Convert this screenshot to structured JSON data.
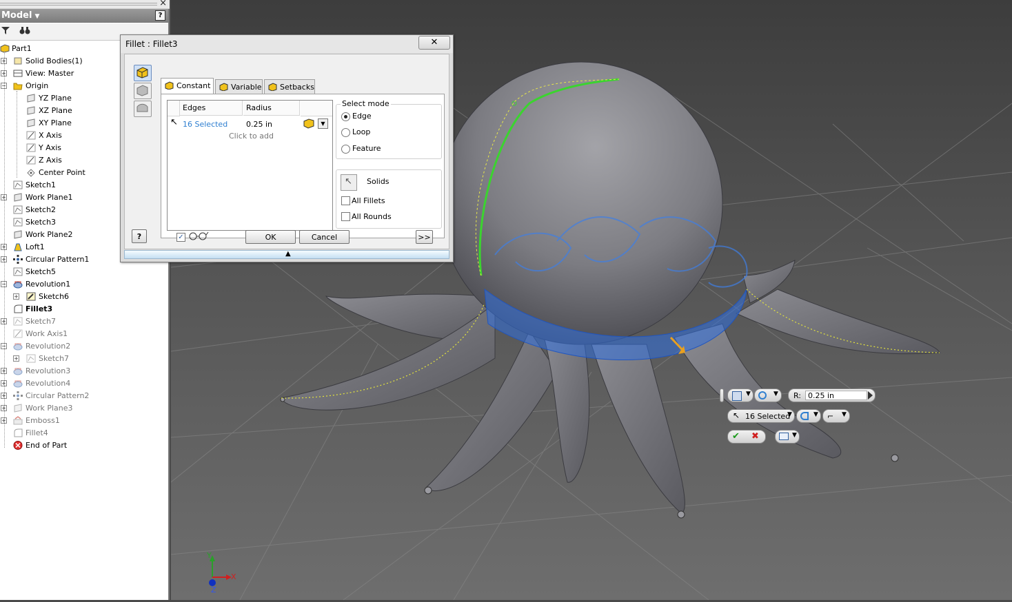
{
  "browser": {
    "title": "Model",
    "help": "?",
    "close": "×",
    "tree": [
      {
        "label": "Part1",
        "x": 0,
        "exp": "",
        "icon": "part-icon",
        "style": ""
      },
      {
        "label": "Solid Bodies(1)",
        "x": 1,
        "exp": "+",
        "icon": "solid-bodies-icon",
        "style": ""
      },
      {
        "label": "View: Master",
        "x": 1,
        "exp": "+",
        "icon": "view-icon",
        "style": ""
      },
      {
        "label": "Origin",
        "x": 1,
        "exp": "-",
        "icon": "folder-icon",
        "style": ""
      },
      {
        "label": "YZ Plane",
        "x": 2,
        "exp": "",
        "icon": "plane-icon",
        "style": ""
      },
      {
        "label": "XZ Plane",
        "x": 2,
        "exp": "",
        "icon": "plane-icon",
        "style": ""
      },
      {
        "label": "XY Plane",
        "x": 2,
        "exp": "",
        "icon": "plane-icon",
        "style": ""
      },
      {
        "label": "X Axis",
        "x": 2,
        "exp": "",
        "icon": "axis-icon",
        "style": ""
      },
      {
        "label": "Y Axis",
        "x": 2,
        "exp": "",
        "icon": "axis-icon",
        "style": ""
      },
      {
        "label": "Z Axis",
        "x": 2,
        "exp": "",
        "icon": "axis-icon",
        "style": ""
      },
      {
        "label": "Center Point",
        "x": 2,
        "exp": "",
        "icon": "point-icon",
        "style": ""
      },
      {
        "label": "Sketch1",
        "x": 1,
        "exp": "",
        "icon": "sketch-icon",
        "style": ""
      },
      {
        "label": "Work Plane1",
        "x": 1,
        "exp": "+",
        "icon": "plane-icon",
        "style": ""
      },
      {
        "label": "Sketch2",
        "x": 1,
        "exp": "",
        "icon": "sketch-icon",
        "style": ""
      },
      {
        "label": "Sketch3",
        "x": 1,
        "exp": "",
        "icon": "sketch-icon",
        "style": ""
      },
      {
        "label": "Work Plane2",
        "x": 1,
        "exp": "",
        "icon": "plane-icon",
        "style": ""
      },
      {
        "label": "Loft1",
        "x": 1,
        "exp": "+",
        "icon": "loft-icon",
        "style": ""
      },
      {
        "label": "Circular Pattern1",
        "x": 1,
        "exp": "+",
        "icon": "pattern-icon",
        "style": ""
      },
      {
        "label": "Sketch5",
        "x": 1,
        "exp": "",
        "icon": "sketch-icon",
        "style": ""
      },
      {
        "label": "Revolution1",
        "x": 1,
        "exp": "-",
        "icon": "revolve-icon",
        "style": ""
      },
      {
        "label": "Sketch6",
        "x": 2,
        "exp": "+",
        "icon": "sketch-active-icon",
        "style": ""
      },
      {
        "label": "Fillet3",
        "x": 1,
        "exp": "",
        "icon": "fillet-icon",
        "style": "bold"
      },
      {
        "label": "Sketch7",
        "x": 1,
        "exp": "+",
        "icon": "sketch-icon",
        "style": "dim"
      },
      {
        "label": "Work Axis1",
        "x": 1,
        "exp": "",
        "icon": "axis-icon",
        "style": "dim"
      },
      {
        "label": "Revolution2",
        "x": 1,
        "exp": "-",
        "icon": "revolve-icon",
        "style": "dim"
      },
      {
        "label": "Sketch7",
        "x": 2,
        "exp": "+",
        "icon": "sketch-icon",
        "style": "dim"
      },
      {
        "label": "Revolution3",
        "x": 1,
        "exp": "+",
        "icon": "revolve-icon",
        "style": "dim"
      },
      {
        "label": "Revolution4",
        "x": 1,
        "exp": "+",
        "icon": "revolve-icon",
        "style": "dim"
      },
      {
        "label": "Circular Pattern2",
        "x": 1,
        "exp": "+",
        "icon": "pattern-icon",
        "style": "dim"
      },
      {
        "label": "Work Plane3",
        "x": 1,
        "exp": "+",
        "icon": "plane-icon",
        "style": "dim"
      },
      {
        "label": "Emboss1",
        "x": 1,
        "exp": "+",
        "icon": "emboss-icon",
        "style": "dim"
      },
      {
        "label": "Fillet4",
        "x": 1,
        "exp": "",
        "icon": "fillet-icon",
        "style": "dim"
      },
      {
        "label": "End of Part",
        "x": 1,
        "exp": "",
        "icon": "end-of-part-icon",
        "style": ""
      }
    ]
  },
  "dialog": {
    "title": "Fillet : Fillet3",
    "close": "✕",
    "tabs": {
      "constant": "Constant",
      "variable": "Variable",
      "setbacks": "Setbacks"
    },
    "table": {
      "col_edges": "Edges",
      "col_radius": "Radius",
      "row_edges": "16 Selected",
      "row_radius": "0.25 in",
      "click_to_add": "Click to add"
    },
    "select_mode": {
      "legend": "Select mode",
      "edge": "Edge",
      "loop": "Loop",
      "feature": "Feature",
      "selected": "Edge"
    },
    "solids": {
      "label": "Solids",
      "all_fillets": "All Fillets",
      "all_rounds": "All Rounds"
    },
    "ok": "OK",
    "cancel": "Cancel",
    "more": ">>",
    "help": "?",
    "preview_checked": "✓"
  },
  "minitoolbar": {
    "radius_prefix": "R:",
    "radius_value": "0.25 in",
    "selected": "16 Selected"
  },
  "triad": {
    "x": "X",
    "y": "Y",
    "z": "Z"
  },
  "colors": {
    "accent_blue": "#2f7fd0",
    "selection_green": "#3bd42f",
    "highlight_blue": "#2f6fe0"
  }
}
